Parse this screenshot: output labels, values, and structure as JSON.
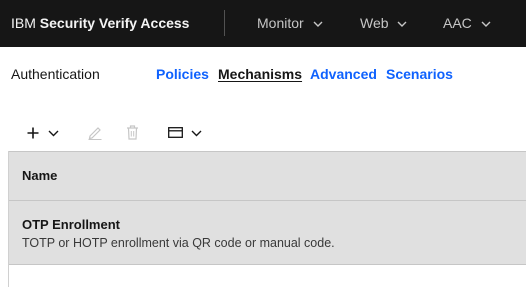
{
  "header": {
    "brand_prefix": "IBM",
    "brand_name": "Security Verify Access",
    "menus": [
      {
        "label": "Monitor"
      },
      {
        "label": "Web"
      },
      {
        "label": "AAC"
      }
    ]
  },
  "subnav": {
    "title": "Authentication",
    "links": [
      {
        "label": "Policies",
        "active": false
      },
      {
        "label": "Mechanisms",
        "active": true
      },
      {
        "label": "Advanced",
        "active": false
      },
      {
        "label": "Scenarios",
        "active": false
      }
    ]
  },
  "toolbar": {
    "icons": [
      "add-icon",
      "chevron-down-icon",
      "edit-icon",
      "delete-icon",
      "view-icon",
      "chevron-down-icon"
    ]
  },
  "table": {
    "columns": [
      "Name"
    ],
    "rows": [
      {
        "title": "OTP Enrollment",
        "description": "TOTP or HOTP enrollment via QR code or manual code."
      }
    ]
  },
  "colors": {
    "header_bg": "#161616",
    "link": "#0f62fe",
    "table_bg": "#e0e0e0"
  }
}
